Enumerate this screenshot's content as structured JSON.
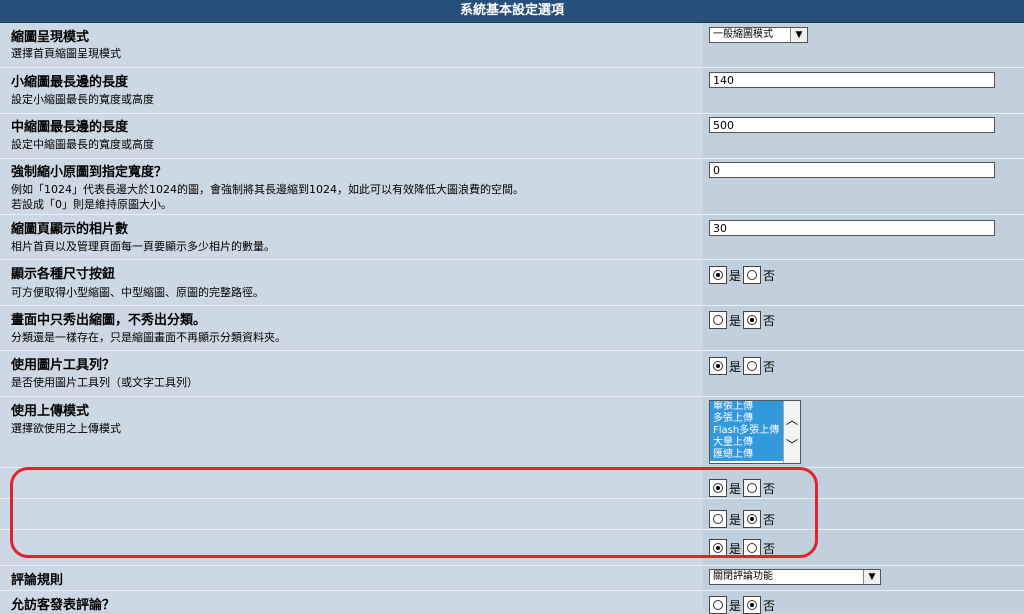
{
  "header": {
    "title": "系統基本設定選項"
  },
  "rows": [
    {
      "title": "縮圖呈現模式",
      "desc": "選擇首頁縮圖呈現模式",
      "select_value": "一般縮圖模式"
    },
    {
      "title": "小縮圖最長邊的長度",
      "desc": "設定小縮圖最長的寬度或高度",
      "value": "140"
    },
    {
      "title": "中縮圖最長邊的長度",
      "desc": "設定中縮圖最長的寬度或高度",
      "value": "500"
    },
    {
      "title": "強制縮小原圖到指定寬度？",
      "desc1": "例如「1024」代表長邊大於1024的圖，會強制將其長邊縮到1024，如此可以有效降低大圖浪費的空間。",
      "desc2": "若設成「0」則是維持原圖大小。",
      "value": "0"
    },
    {
      "title": "縮圖頁顯示的相片數",
      "desc": "相片首頁以及管理頁面每一頁要顯示多少相片的數量。",
      "value": "30"
    },
    {
      "title": "顯示各種尺寸按鈕",
      "desc": "可方便取得小型縮圖、中型縮圖、原圖的完整路徑。"
    },
    {
      "title": "畫面中只秀出縮圖，不秀出分類。",
      "desc": "分類還是一樣存在，只是縮圖畫面不再顯示分類資料夾。"
    },
    {
      "title": "使用圖片工具列？",
      "desc": "是否使用圖片工具列（或文字工具列）"
    },
    {
      "title": "使用上傳模式",
      "desc": "選擇欲使用之上傳模式"
    },
    {
      "title": "評論規則",
      "select_value": "關閉評論功能"
    },
    {
      "title": "允訪客發表評論？"
    }
  ],
  "radio": {
    "yes": "是",
    "no": "否"
  },
  "upload_modes": [
    "單張上傳",
    "多張上傳",
    "Flash多張上傳",
    "大量上傳",
    "匯總上傳"
  ]
}
